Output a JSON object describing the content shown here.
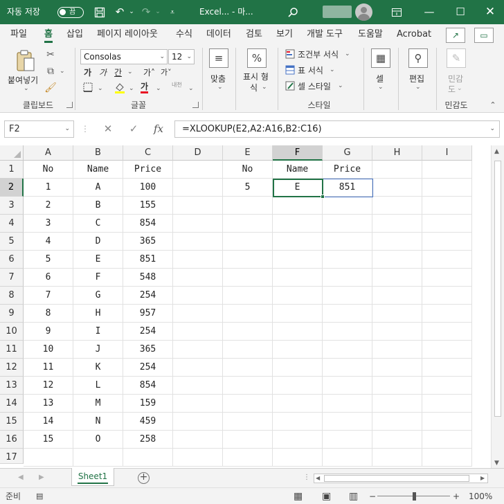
{
  "titlebar": {
    "autosave_label": "자동 저장",
    "autosave_state": "끔",
    "filename": "Excel... - 마...",
    "colors": {
      "accent": "#217346"
    }
  },
  "tabs": [
    {
      "label": "파일"
    },
    {
      "label": "홈",
      "active": true
    },
    {
      "label": "삽입"
    },
    {
      "label": "페이지 레이아웃"
    },
    {
      "label": "수식"
    },
    {
      "label": "데이터"
    },
    {
      "label": "검토"
    },
    {
      "label": "보기"
    },
    {
      "label": "개발 도구"
    },
    {
      "label": "도움말"
    },
    {
      "label": "Acrobat"
    }
  ],
  "ribbon": {
    "paste_label": "붙여넣기",
    "clipboard_group": "클립보드",
    "font_name": "Consolas",
    "font_size": "12",
    "font_group": "글꼴",
    "align_label": "맞춤",
    "number_label_1": "표시 형",
    "number_label_2": "식",
    "number_icon": "%",
    "conditional_format": "조건부 서식",
    "table_format": "표 서식",
    "cell_style": "셀 스타일",
    "styles_group": "스타일",
    "cells_label": "셀",
    "editing_label": "편집",
    "sensitivity_label_1": "민감",
    "sensitivity_label_2": "도",
    "sensitivity_group": "민감도",
    "bold_glyph": "가",
    "italic_glyph": "가",
    "underline_glyph": "간",
    "grow_font_glyph": "가˄",
    "shrink_font_glyph": "가˅",
    "font_color_glyph": "가",
    "phonetic_glyph": "내천"
  },
  "formula_bar": {
    "name_box": "F2",
    "cancel_icon": "✕",
    "enter_icon": "✓",
    "fx_label": "fx",
    "formula": "=XLOOKUP(E2,A2:A16,B2:C16)"
  },
  "grid": {
    "columns": [
      "A",
      "B",
      "C",
      "D",
      "E",
      "F",
      "G",
      "H",
      "I"
    ],
    "rows": [
      "1",
      "2",
      "3",
      "4",
      "5",
      "6",
      "7",
      "8",
      "9",
      "10",
      "11",
      "12",
      "13",
      "14",
      "15",
      "16",
      "17"
    ],
    "table": [
      [
        "No",
        "Name",
        "Price"
      ],
      [
        "1",
        "A",
        "100"
      ],
      [
        "2",
        "B",
        "155"
      ],
      [
        "3",
        "C",
        "854"
      ],
      [
        "4",
        "D",
        "365"
      ],
      [
        "5",
        "E",
        "851"
      ],
      [
        "6",
        "F",
        "548"
      ],
      [
        "7",
        "G",
        "254"
      ],
      [
        "8",
        "H",
        "957"
      ],
      [
        "9",
        "I",
        "254"
      ],
      [
        "10",
        "J",
        "365"
      ],
      [
        "11",
        "K",
        "254"
      ],
      [
        "12",
        "L",
        "854"
      ],
      [
        "13",
        "M",
        "159"
      ],
      [
        "14",
        "N",
        "459"
      ],
      [
        "15",
        "O",
        "258"
      ]
    ],
    "lookup": [
      [
        "No",
        "Name",
        "Price"
      ],
      [
        "5",
        "E",
        "851"
      ]
    ],
    "active_cell": "F2"
  },
  "sheets": [
    {
      "label": "Sheet1",
      "active": true
    }
  ],
  "statusbar": {
    "ready": "준비",
    "zoom": "100%",
    "zoom_minus": "−",
    "zoom_plus": "+"
  }
}
